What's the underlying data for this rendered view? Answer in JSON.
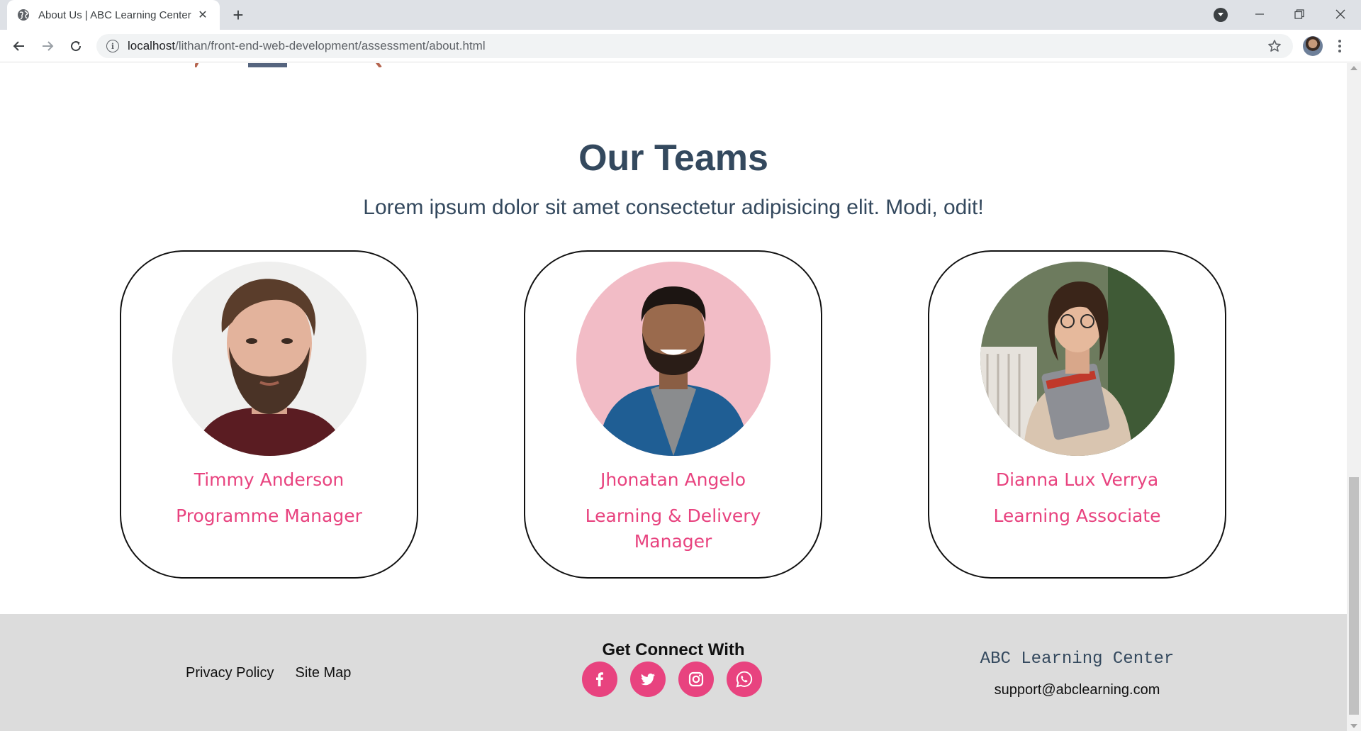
{
  "browser": {
    "tab_title": "About Us | ABC Learning Center",
    "url_host": "localhost",
    "url_path": "/lithan/front-end-web-development/assessment/about.html"
  },
  "teams": {
    "title": "Our Teams",
    "subtitle": "Lorem ipsum dolor sit amet consectetur adipisicing elit. Modi, odit!",
    "members": [
      {
        "name": "Timmy Anderson",
        "role": "Programme Manager"
      },
      {
        "name": "Jhonatan Angelo",
        "role": "Learning & Delivery Manager"
      },
      {
        "name": "Dianna Lux Verrya",
        "role": "Learning Associate"
      }
    ]
  },
  "footer": {
    "links": [
      "Privacy Policy",
      "Site Map"
    ],
    "connect_title": "Get Connect With",
    "socials": [
      "facebook-icon",
      "twitter-icon",
      "instagram-icon",
      "whatsapp-icon"
    ],
    "brand": "ABC Learning Center",
    "email": "support@abclearning.com"
  },
  "colors": {
    "accent": "#e8437f",
    "heading": "#34495e",
    "footer_bg": "#dcdcdc"
  }
}
